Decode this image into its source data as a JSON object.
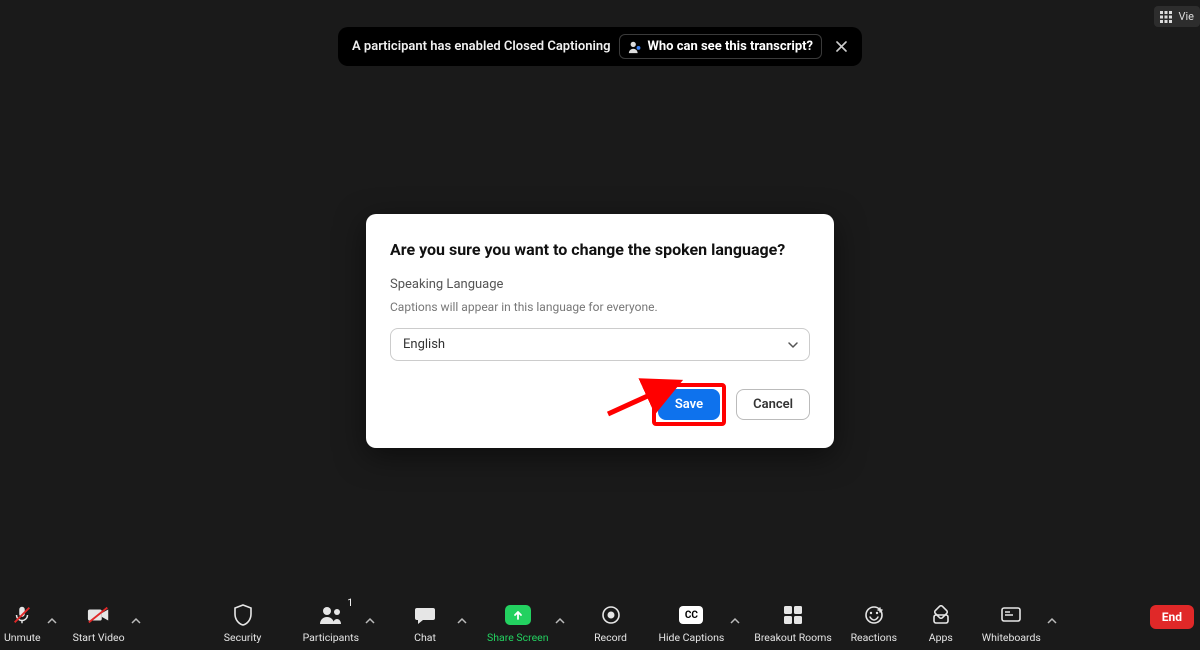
{
  "top_right": {
    "view_label": "Vie"
  },
  "notification": {
    "message": "A participant has enabled Closed Captioning",
    "who_link": "Who can see this transcript?"
  },
  "dialog": {
    "title": "Are you sure you want to change the spoken language?",
    "section_label": "Speaking Language",
    "help_text": "Captions will appear in this language for everyone.",
    "selected_language": "English",
    "save_label": "Save",
    "cancel_label": "Cancel"
  },
  "toolbar": {
    "unmute": "Unmute",
    "start_video": "Start Video",
    "security": "Security",
    "participants": "Participants",
    "participants_count": "1",
    "chat": "Chat",
    "share_screen": "Share Screen",
    "record": "Record",
    "hide_captions": "Hide Captions",
    "breakout_rooms": "Breakout Rooms",
    "reactions": "Reactions",
    "apps": "Apps",
    "whiteboards": "Whiteboards",
    "end": "End"
  }
}
